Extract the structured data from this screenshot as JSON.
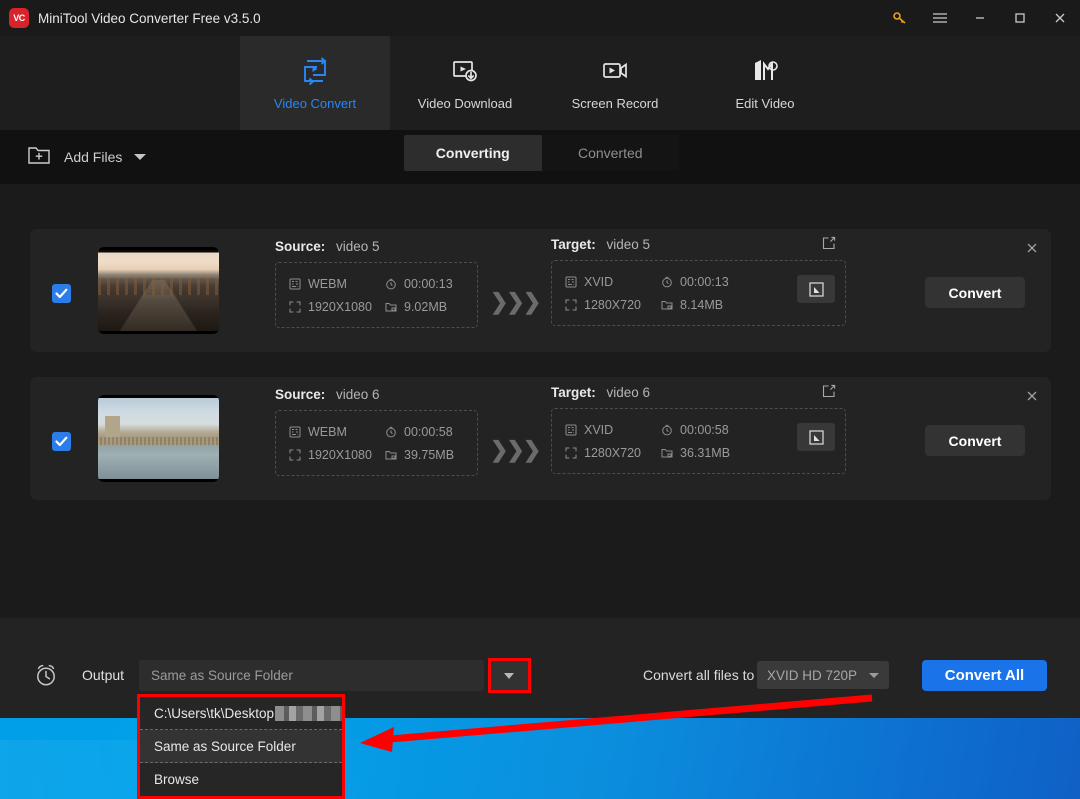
{
  "window": {
    "title": "MiniTool Video Converter Free v3.5.0",
    "logo_text": "VC",
    "controls": {
      "key": "key-icon",
      "menu": "hamburger-menu-icon",
      "minimize": "minimize-icon",
      "maximize": "maximize-icon",
      "close": "close-icon"
    }
  },
  "nav": {
    "tabs": [
      {
        "label": "Video Convert",
        "icon": "video-convert-icon",
        "active": true
      },
      {
        "label": "Video Download",
        "icon": "video-download-icon",
        "active": false
      },
      {
        "label": "Screen Record",
        "icon": "screen-record-icon",
        "active": false
      },
      {
        "label": "Edit Video",
        "icon": "edit-video-icon",
        "active": false
      }
    ]
  },
  "toolbar": {
    "add_files_label": "Add Files",
    "add_files_icon": "add-folder-icon",
    "dropdown_icon": "chevron-down-icon",
    "segments": [
      {
        "label": "Converting",
        "active": true
      },
      {
        "label": "Converted",
        "active": false
      }
    ]
  },
  "labels": {
    "source": "Source:",
    "target": "Target:",
    "convert": "Convert",
    "arrows": "❯❯❯"
  },
  "files": [
    {
      "checked": true,
      "thumbnail": "pier-sunset-thumbnail",
      "source": {
        "name": "video 5",
        "format": "WEBM",
        "duration": "00:00:13",
        "resolution": "1920X1080",
        "size": "9.02MB"
      },
      "target": {
        "name": "video 5",
        "format": "XVID",
        "duration": "00:00:13",
        "resolution": "1280X720",
        "size": "8.14MB"
      }
    },
    {
      "checked": true,
      "thumbnail": "parliament-thames-thumbnail",
      "source": {
        "name": "video 6",
        "format": "WEBM",
        "duration": "00:00:58",
        "resolution": "1920X1080",
        "size": "39.75MB"
      },
      "target": {
        "name": "video 6",
        "format": "XVID",
        "duration": "00:00:58",
        "resolution": "1280X720",
        "size": "36.31MB"
      }
    }
  ],
  "bottom": {
    "clock_icon": "alarm-clock-icon",
    "output_label": "Output",
    "output_value": "Same as Source Folder",
    "convert_all_to_label": "Convert all files to",
    "preset_value": "XVID HD 720P",
    "convert_all_button": "Convert All"
  },
  "dropdown": {
    "items": [
      {
        "label": "C:\\Users\\tk\\Desktop",
        "redacted": true,
        "selected": false
      },
      {
        "label": "Same as Source Folder",
        "redacted": false,
        "selected": true
      },
      {
        "label": "Browse",
        "redacted": false,
        "selected": false
      }
    ]
  },
  "colors": {
    "accent": "#1a73e8",
    "nav_active_text": "#2986f5",
    "annotation": "#ff0000",
    "logo": "#d8232a",
    "checkbox": "#2b7de9"
  }
}
